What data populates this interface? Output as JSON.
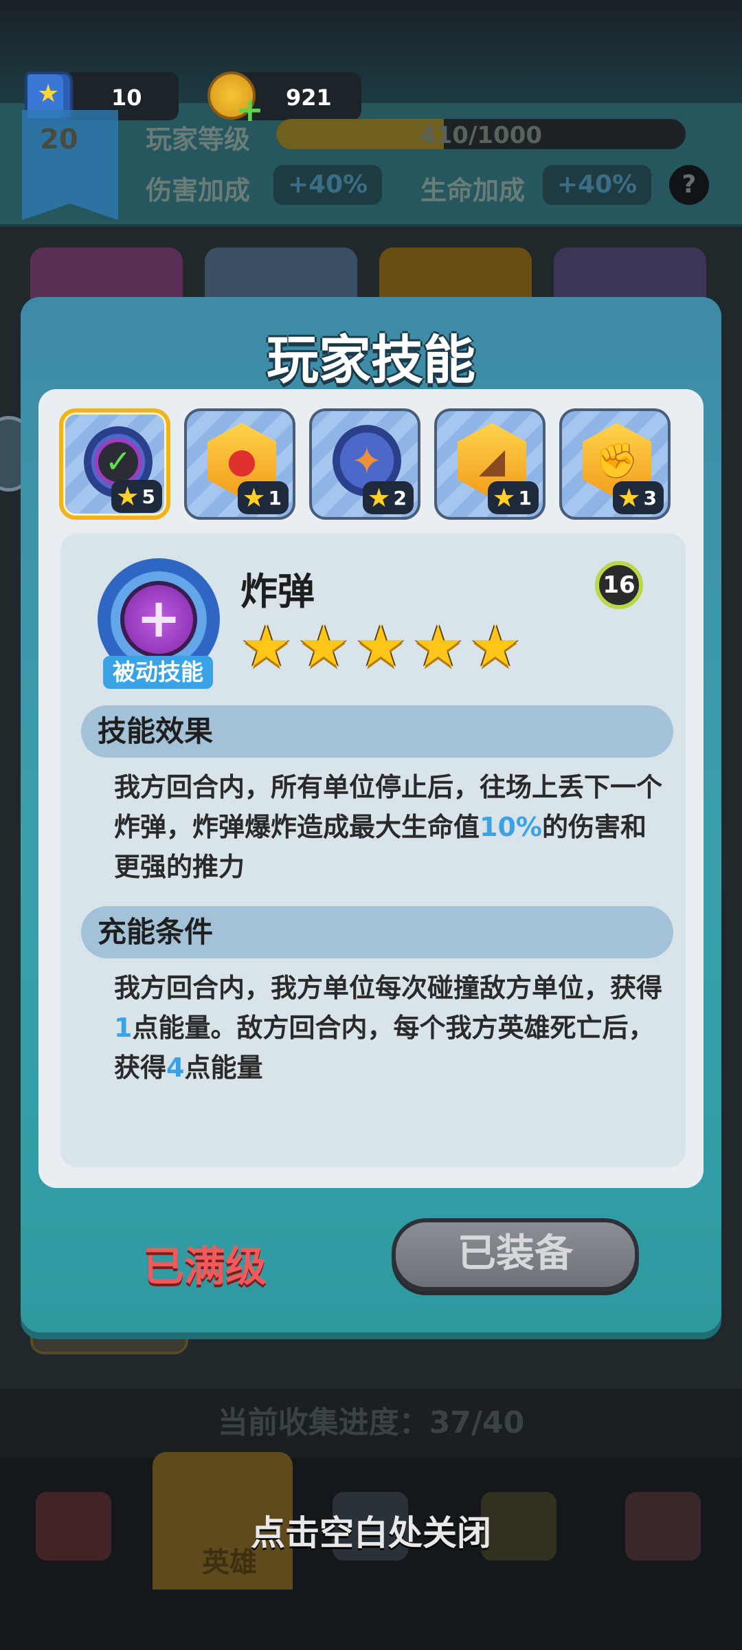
{
  "resources": {
    "books": "10",
    "coins": "921"
  },
  "player": {
    "level": "20",
    "level_label": "玩家等级",
    "xp_text": "410/1000",
    "xp_fraction": 0.41,
    "damage_label": "伤害加成",
    "damage_value": "+40%",
    "health_label": "生命加成",
    "health_value": "+40%",
    "help": "?"
  },
  "modal": {
    "title": "玩家技能",
    "tabs": [
      {
        "icon": "check-badge-icon",
        "stars": "5",
        "selected": true
      },
      {
        "icon": "boxing-glove-icon",
        "stars": "1"
      },
      {
        "icon": "firework-rocket-icon",
        "stars": "2"
      },
      {
        "icon": "horn-icon",
        "stars": "1"
      },
      {
        "icon": "fist-icon",
        "stars": "3"
      }
    ],
    "skill": {
      "name": "炸弹",
      "type_tag": "被动技能",
      "level": "16",
      "star_rating": 5,
      "effect_title": "技能效果",
      "effect_text_1": "我方回合内，所有单位停止后，往场上丢下一个炸弹，炸弹爆炸造成最大生命值",
      "effect_highlight": "10%",
      "effect_text_2": "的伤害和更强的推力",
      "charge_title": "充能条件",
      "charge_text_1": "我方回合内，我方单位每次碰撞敌方单位，获得",
      "charge_highlight_1": "1",
      "charge_text_2": "点能量。敌方回合内，每个我方英雄死亡后，获得",
      "charge_highlight_2": "4",
      "charge_text_3": "点能量"
    },
    "maxed_label": "已满级",
    "equipped_label": "已装备"
  },
  "footer": {
    "collection_progress": "当前收集进度：37/40",
    "hero_tab": "英雄",
    "close_hint": "点击空白处关闭"
  },
  "colors": {
    "highlight": "#3aa3e6",
    "maxed": "#f15a5a",
    "selected_border": "#f2b21b"
  }
}
